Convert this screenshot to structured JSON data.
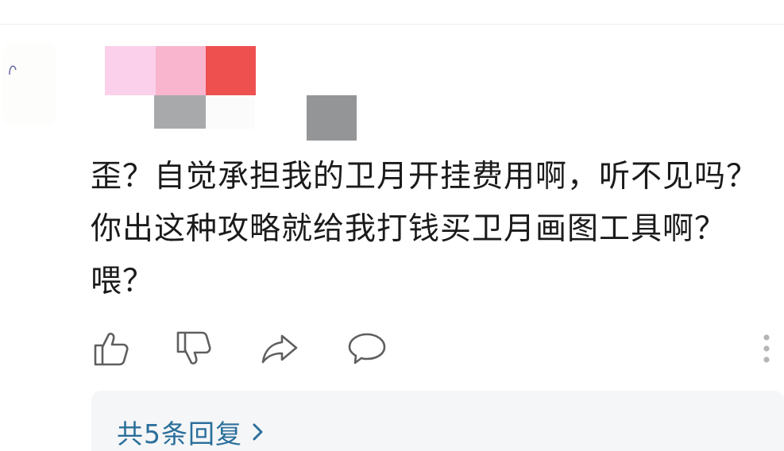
{
  "comment": {
    "author_mosaic_colors": [
      "#fbd0ea",
      "#f9b5ce",
      "#ee5050",
      "#a7a9ab",
      "#fbfbfb",
      "#949597"
    ],
    "text": "歪？自觉承担我的卫月开挂费用啊，听不见吗？你出这种攻略就给我打钱买卫月画图工具啊？喂？",
    "actions": {
      "like_icon": "thumbs-up-icon",
      "dislike_icon": "thumbs-down-icon",
      "share_icon": "share-arrow-icon",
      "reply_icon": "speech-bubble-icon",
      "more_icon": "vertical-ellipsis-icon"
    },
    "replies": {
      "label": "共5条回复",
      "chevron_icon": "chevron-right-icon"
    }
  },
  "colors": {
    "text": "#1b1b1b",
    "icon": "#5f5f5f",
    "link": "#2a6f9b",
    "reply_bg": "#f5f6f7"
  }
}
